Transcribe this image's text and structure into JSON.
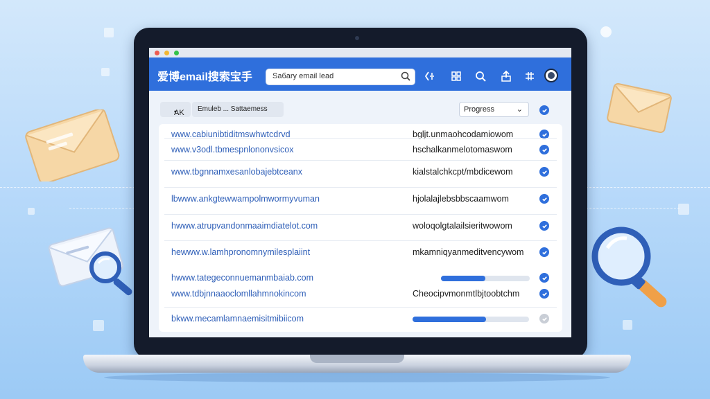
{
  "app": {
    "title": "爱博email搜索宝手",
    "search_value": "Sабary email lead"
  },
  "filters": {
    "prefix_select": "AK",
    "field_value": "Emuleb ... Sattaemess",
    "progress_select": "Progress"
  },
  "rows": [
    {
      "url": "www.cabiunibtiditmswhwtcdrvd",
      "email": "bgljt.unmaohcodamiowom",
      "status": "done"
    },
    {
      "url": "www.v3odl.tbmespnlononvsicox",
      "email": "hschalkanmelotomaswom",
      "status": "done"
    },
    {
      "url": "www.tbgnnamxesanlobajebtceanx",
      "email": "kialstalchkcpt/mbdicewom",
      "status": "done"
    },
    {
      "url": "lbwww.ankgtewwampolmwormyvuman",
      "email": "hjolalajlebsbbscaamwom",
      "status": "done"
    },
    {
      "url": "hwww.atrupvandonmaaimdiatelot.com",
      "email": "woloqolgtalailsieritwowom",
      "status": "done"
    },
    {
      "url": "hewww.w.lamhpronomnymilesplaiint",
      "email": "mkamniqyanmeditvencywom",
      "status": "done"
    },
    {
      "url": "hwww.tategeconnuemanmbaiab.com",
      "email": "",
      "status": "done",
      "progress": 0.5
    },
    {
      "url": "www.tdbjnnaaoclomllahmnokincom",
      "email": "Cheocipvmonmtlbjtoobtchm",
      "status": "done"
    },
    {
      "url": "bkww.mecamlamnaemisitmibiicom",
      "email": "",
      "status": "pending",
      "progress": 0.63
    }
  ],
  "colors": {
    "accent": "#2f6fdc",
    "background": "#b9dafa"
  }
}
